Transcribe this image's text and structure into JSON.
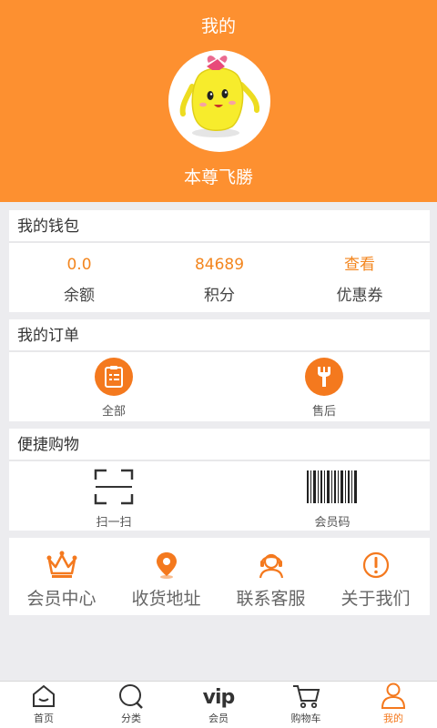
{
  "header": {
    "title": "我的",
    "username": "本尊飞勝"
  },
  "wallet": {
    "title": "我的钱包",
    "items": [
      {
        "value": "0.0",
        "label": "余额"
      },
      {
        "value": "84689",
        "label": "积分"
      },
      {
        "value": "查看",
        "label": "优惠券"
      }
    ]
  },
  "orders": {
    "title": "我的订单",
    "items": [
      {
        "label": "全部",
        "icon": "clipboard-icon"
      },
      {
        "label": "售后",
        "icon": "wrench-icon"
      }
    ]
  },
  "quick": {
    "title": "便捷购物",
    "items": [
      {
        "label": "扫一扫",
        "icon": "scan-icon"
      },
      {
        "label": "会员码",
        "icon": "barcode-icon"
      }
    ]
  },
  "member": {
    "items": [
      {
        "label": "会员中心",
        "icon": "crown-icon"
      },
      {
        "label": "收货地址",
        "icon": "location-pin-icon"
      },
      {
        "label": "联系客服",
        "icon": "headset-icon"
      },
      {
        "label": "关于我们",
        "icon": "info-icon"
      }
    ]
  },
  "tabbar": {
    "items": [
      {
        "label": "首页",
        "icon": "home-icon"
      },
      {
        "label": "分类",
        "icon": "category-icon"
      },
      {
        "label": "会员",
        "icon": "vip-icon",
        "icon_text": "vip"
      },
      {
        "label": "购物车",
        "icon": "cart-icon"
      },
      {
        "label": "我的",
        "icon": "user-icon"
      }
    ],
    "active_index": 4
  },
  "colors": {
    "accent": "#fd9030",
    "icon_orange": "#f4791e",
    "background": "#ececef"
  }
}
